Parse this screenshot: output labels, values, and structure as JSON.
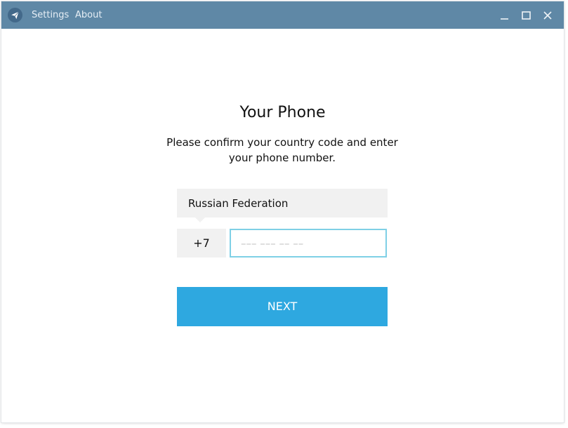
{
  "titlebar": {
    "menu": [
      {
        "label": "Settings"
      },
      {
        "label": "About"
      }
    ],
    "logo_icon": "paper-plane-icon",
    "controls": [
      "minimize-icon",
      "maximize-icon",
      "close-icon"
    ],
    "background_color": "#5f88a6"
  },
  "main": {
    "title": "Your Phone",
    "description": "Please confirm your country code and enter your phone number.",
    "country": "Russian Federation",
    "country_code": "+7",
    "phone_placeholder": "––– ––– –– ––",
    "phone_value": "",
    "next_label": "NEXT",
    "accent_color": "#2ea8e0",
    "input_focus_color": "#7fd0e6"
  }
}
